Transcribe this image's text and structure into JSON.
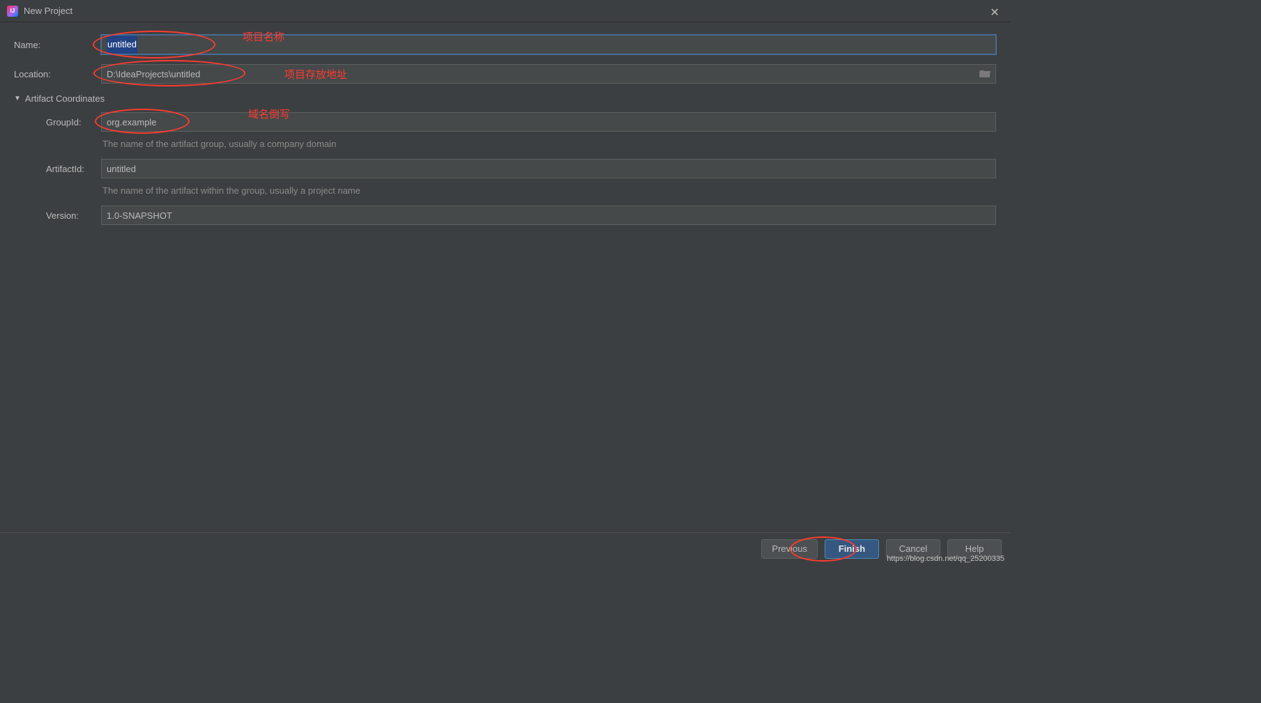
{
  "window": {
    "title": "New Project"
  },
  "form": {
    "name_label": "Name:",
    "name_value": "untitled",
    "location_label": "Location:",
    "location_value": "D:\\IdeaProjects\\untitled",
    "artifact_section": "Artifact Coordinates",
    "groupid_label": "GroupId:",
    "groupid_value": "org.example",
    "groupid_hint": "The name of the artifact group, usually a company domain",
    "artifactid_label": "ArtifactId:",
    "artifactid_value": "untitled",
    "artifactid_hint": "The name of the artifact within the group, usually a project name",
    "version_label": "Version:",
    "version_value": "1.0-SNAPSHOT"
  },
  "annotations": {
    "name": "项目名称",
    "location": "项目存放地址",
    "groupid": "域名倒写"
  },
  "buttons": {
    "previous": "Previous",
    "finish": "Finish",
    "cancel": "Cancel",
    "help": "Help"
  },
  "watermark": "https://blog.csdn.net/qq_25200335"
}
